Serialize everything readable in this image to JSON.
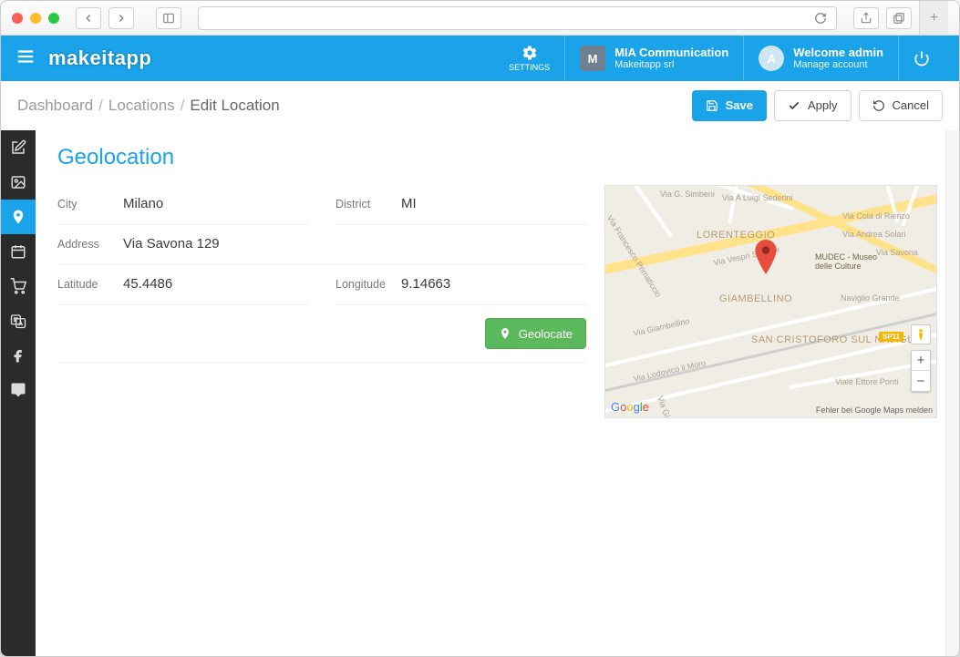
{
  "breadcrumbs": {
    "a": "Dashboard",
    "b": "Locations",
    "c": "Edit Location"
  },
  "actions": {
    "save": "Save",
    "apply": "Apply",
    "cancel": "Cancel"
  },
  "header": {
    "logo": "makeitapp",
    "settings": "SETTINGS",
    "org_initial": "M",
    "org_name": "MIA Communication",
    "org_sub": "Makeitapp srl",
    "user_initial": "A",
    "user_name": "Welcome admin",
    "user_sub": "Manage account"
  },
  "section": {
    "title": "Geolocation",
    "geolocate": "Geolocate"
  },
  "fields": {
    "city_label": "City",
    "city": "Milano",
    "district_label": "District",
    "district": "MI",
    "address_label": "Address",
    "address": "Via Savona 129",
    "lat_label": "Latitude",
    "lat": "45.4486",
    "lng_label": "Longitude",
    "lng": "9.14663"
  },
  "map": {
    "areas": {
      "lorenteggio": "LORENTEGGIO",
      "giambellino": "GIAMBELLINO",
      "san_cristoforo": "SAN CRISTOFORO SUL NAVIGLIO"
    },
    "streets": {
      "simbeni": "Via G. Simbeni",
      "sederini": "Via A Luigi Sederini",
      "primaticcio": "Via Francesco Primaticcio",
      "vespri": "Via Vespri Siciliani",
      "cola": "Via Cola di Rienzo",
      "andrea": "Via Andrea Solari",
      "savona": "Via Savona",
      "naviglio": "Naviglio Grande",
      "giambellino": "Via Giambellino",
      "lodovico": "Via Lodovico il Moro",
      "ettore": "Viale Ettore Ponti",
      "giacinto": "Via Giacinto"
    },
    "poi": {
      "mudec1": "MUDEC - Museo",
      "mudec2": "delle Culture"
    },
    "badge": "SP11",
    "google": [
      "G",
      "o",
      "o",
      "g",
      "l",
      "e"
    ],
    "error": "Fehler bei Google Maps melden"
  }
}
